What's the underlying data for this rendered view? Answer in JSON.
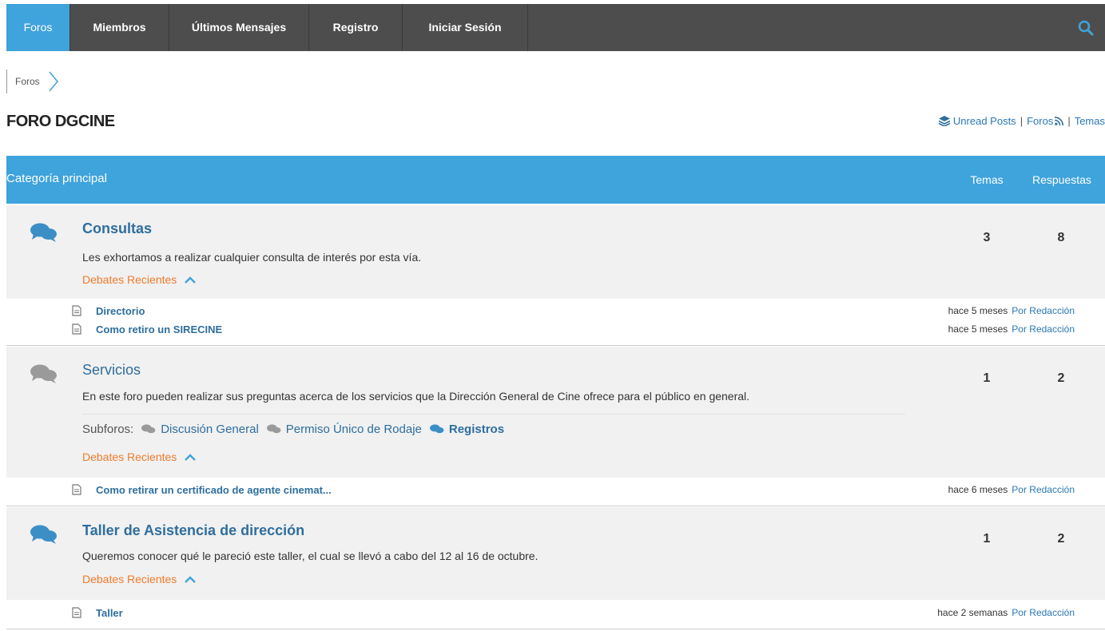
{
  "nav": {
    "items": [
      "Foros",
      "Miembros",
      "Últimos Mensajes",
      "Registro",
      "Iniciar Sesión"
    ],
    "active": 0,
    "search_icon": "search-icon"
  },
  "breadcrumb": {
    "label": "Foros"
  },
  "page": {
    "title": "FORO DGCINE"
  },
  "toplinks": {
    "unread": "Unread Posts",
    "foros": "Foros",
    "temas": "Temas"
  },
  "category": {
    "label": "Categoría principal",
    "col_temas": "Temas",
    "col_respuestas": "Respuestas"
  },
  "forums": [
    {
      "title": "Consultas",
      "description": "Les exhortamos a realizar cualquier consulta de interés por esta vía.",
      "recent_label": "Debates Recientes",
      "temas": "3",
      "respuestas": "8",
      "topics": [
        {
          "title": "Directorio",
          "time": "hace 5 meses",
          "author": "Por Redacción"
        },
        {
          "title": "Como retiro un SIRECINE",
          "time": "hace 5 meses",
          "author": "Por Redacción"
        }
      ]
    },
    {
      "title": "Servicios",
      "description": "En este foro pueden realizar sus preguntas acerca de los servicios que la Dirección General de Cine ofrece para el público en general.",
      "subforos_label": "Subforos:",
      "subforos": [
        "Discusión General",
        "Permiso Único de Rodaje",
        "Registros"
      ],
      "recent_label": "Debates Recientes",
      "temas": "1",
      "respuestas": "2",
      "topics": [
        {
          "title": "Como retirar un certificado de agente cinemat...",
          "time": "hace 6 meses",
          "author": "Por Redacción"
        }
      ]
    },
    {
      "title": "Taller de Asistencia de dirección",
      "description": "Queremos conocer qué le pareció este taller, el cual se llevó a cabo del 12 al 16 de octubre.",
      "recent_label": "Debates Recientes",
      "temas": "1",
      "respuestas": "2",
      "topics": [
        {
          "title": "Taller",
          "time": "hace 2 semanas",
          "author": "Por Redacción"
        }
      ]
    }
  ],
  "colors": {
    "accent": "#3fa3dc",
    "nav_bg": "#4d4d4d",
    "link": "#2e6e9e",
    "recent": "#ef7b2d"
  }
}
